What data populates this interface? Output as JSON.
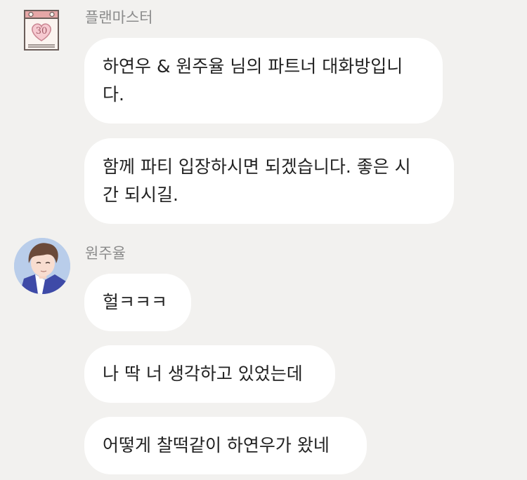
{
  "messages_group_1": {
    "sender": "플랜마스터",
    "avatar_number": "30",
    "bubbles": [
      "하연우 & 원주율 님의 파트너 대화방입니\n다.",
      "함께 파티 입장하시면 되겠습니다. 좋은 시\n간 되시길."
    ]
  },
  "messages_group_2": {
    "sender": "원주율",
    "bubbles": [
      "헐ㅋㅋㅋ",
      "나 딱 너 생각하고 있었는데",
      "어떻게 찰떡같이 하연우가 왔네"
    ]
  },
  "colors": {
    "background": "#f2f1ef",
    "bubble": "#ffffff",
    "text": "#222222",
    "sender_text": "#8b8b8b",
    "calendar_accent": "#e6a7a7"
  }
}
